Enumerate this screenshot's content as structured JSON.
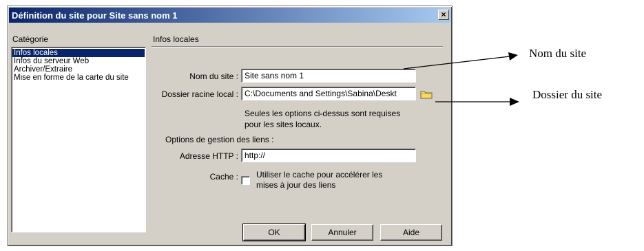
{
  "window": {
    "title": "Définition du site pour  Site sans nom 1",
    "close_glyph": "×"
  },
  "sidebar": {
    "heading": "Catégorie",
    "items": [
      {
        "label": "Infos locales",
        "selected": true
      },
      {
        "label": "Infos du serveur Web"
      },
      {
        "label": "Archiver/Extraire"
      },
      {
        "label": "Mise en forme de la carte du site"
      }
    ]
  },
  "panel": {
    "title": "Infos locales",
    "site_name": {
      "label": "Nom du site :",
      "value": "Site sans nom 1"
    },
    "root_folder": {
      "label": "Dossier racine local :",
      "value": "C:\\Documents and Settings\\Sabina\\Deskt",
      "icon": "folder-icon"
    },
    "note_line1": "Seules les options ci-dessus sont requises",
    "note_line2": "pour les sites locaux.",
    "link_options_heading": "Options de gestion des liens :",
    "http": {
      "label": "Adresse HTTP :",
      "value": "http://"
    },
    "cache": {
      "label": "Cache :",
      "option_line1": "Utiliser le cache pour accélérer les",
      "option_line2": "mises à jour des liens",
      "checked": false
    }
  },
  "buttons": {
    "ok": "OK",
    "cancel": "Annuler",
    "help": "Aide"
  },
  "annotations": {
    "site_name": "Nom du site",
    "site_folder": "Dossier du site"
  }
}
